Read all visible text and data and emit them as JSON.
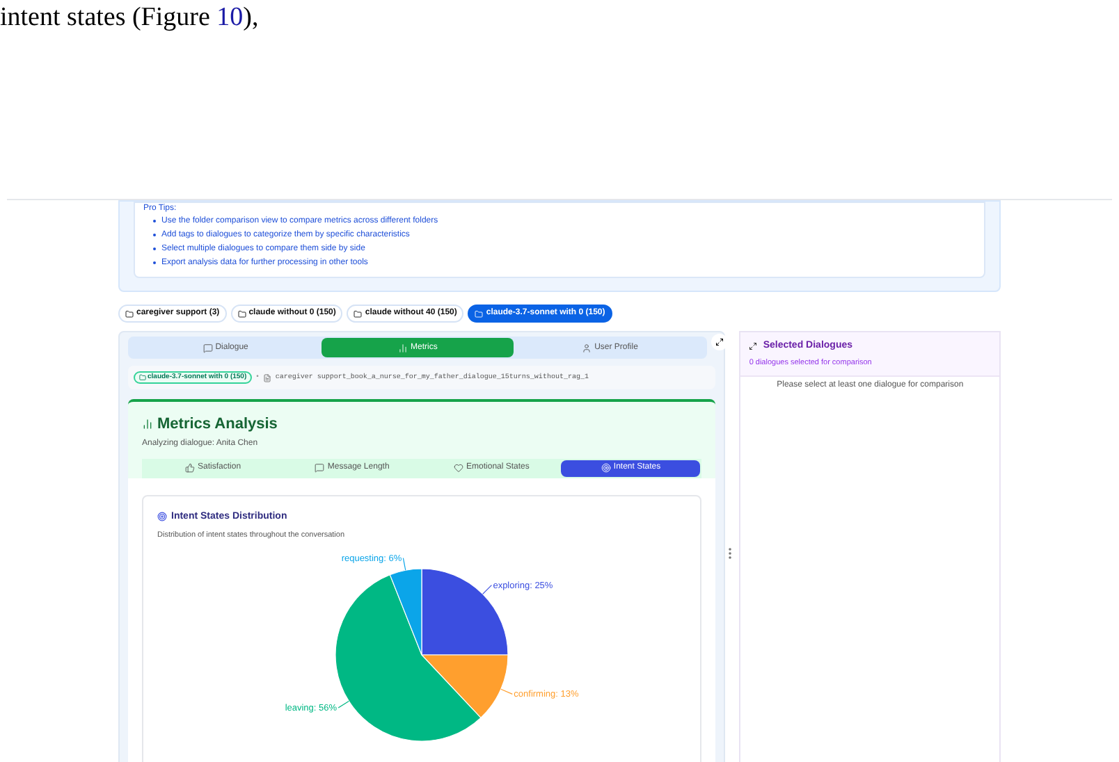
{
  "paper_text": {
    "before": "intent states (Figure ",
    "link": "10",
    "after": "),"
  },
  "pro_tips": {
    "title": "Pro Tips:",
    "items": [
      "Use the folder comparison view to compare metrics across different folders",
      "Add tags to dialogues to categorize them by specific characteristics",
      "Select multiple dialogues to compare them side by side",
      "Export analysis data for further processing in other tools"
    ]
  },
  "folders": [
    {
      "label": "caregiver support (3)",
      "selected": false
    },
    {
      "label": "claude without 0 (150)",
      "selected": false
    },
    {
      "label": "claude without 40 (150)",
      "selected": false
    },
    {
      "label": "claude-3.7-sonnet with 0 (150)",
      "selected": true
    }
  ],
  "main_tabs": [
    {
      "label": "Dialogue",
      "kind": "chat",
      "selected": false
    },
    {
      "label": "Metrics",
      "kind": "bars",
      "selected": true
    },
    {
      "label": "User Profile",
      "kind": "user",
      "selected": false
    }
  ],
  "breadcrumb": {
    "folder": "claude-3.7-sonnet with 0 (150)",
    "separator": "•",
    "file": "caregiver support_book_a_nurse_for_my_father_dialogue_15turns_without_rag_1"
  },
  "metrics": {
    "title": "Metrics Analysis",
    "subtitle": "Analyzing dialogue: Anita Chen",
    "tabs": [
      {
        "label": "Satisfaction",
        "kind": "thumb",
        "selected": false
      },
      {
        "label": "Message Length",
        "kind": "chat",
        "selected": false
      },
      {
        "label": "Emotional States",
        "kind": "heart",
        "selected": false
      },
      {
        "label": "Intent States",
        "kind": "target",
        "selected": true
      }
    ],
    "card": {
      "title": "Intent States Distribution",
      "description": "Distribution of intent states throughout the conversation",
      "chart_data": {
        "type": "pie",
        "categories": [
          "exploring",
          "confirming",
          "leaving",
          "requesting"
        ],
        "values": [
          25,
          13,
          56,
          6
        ],
        "colors": [
          "#3b4ee0",
          "#ff9f2e",
          "#00b884",
          "#0ba5e9"
        ],
        "value_labels": [
          "25%",
          "13%",
          "56%",
          "6%"
        ]
      }
    }
  },
  "selected_panel": {
    "title": "Selected Dialogues",
    "count_text": "0 dialogues selected for comparison",
    "empty_text": "Please select at least one dialogue for comparison"
  }
}
